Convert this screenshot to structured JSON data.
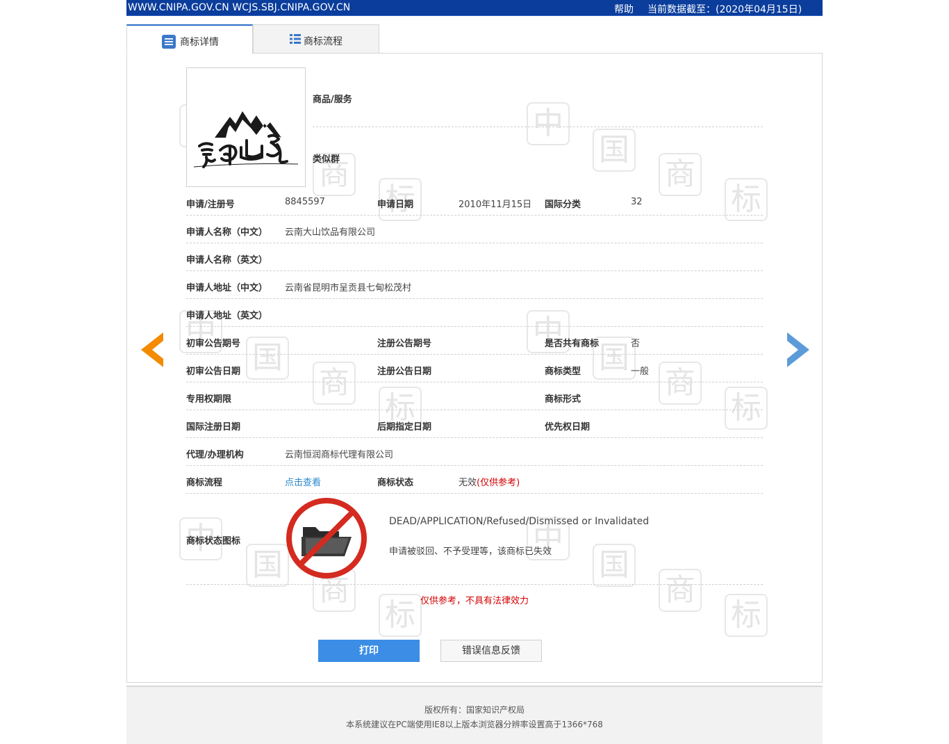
{
  "topbar": {
    "site": "WWW.CNIPA.GOV.CN WCJS.SBJ.CNIPA.GOV.CN",
    "help": "帮助",
    "date": "当前数据截至：(2020年04月15日)"
  },
  "tabs": [
    {
      "label": "商标详情"
    },
    {
      "label": "商标流程"
    }
  ],
  "watermark": {
    "chars": [
      "中",
      "国",
      "商",
      "标"
    ]
  },
  "logo": {
    "text": "雲南山泉"
  },
  "goods": {
    "label": "商品/服务",
    "value": ""
  },
  "similar_group": {
    "label": "类似群",
    "value": ""
  },
  "fields": {
    "reg_no": {
      "label": "申请/注册号",
      "value": "8845597"
    },
    "app_date": {
      "label": "申请日期",
      "value": "2010年11月15日"
    },
    "intl_class": {
      "label": "国际分类",
      "value": "32"
    },
    "applicant_cn": {
      "label": "申请人名称（中文）",
      "value": "云南大山饮品有限公司"
    },
    "applicant_en": {
      "label": "申请人名称（英文）",
      "value": ""
    },
    "address_cn": {
      "label": "申请人地址（中文）",
      "value": "云南省昆明市呈贡县七甸松茂村"
    },
    "address_en": {
      "label": "申请人地址（英文）",
      "value": ""
    },
    "prelim_pub_no": {
      "label": "初审公告期号",
      "value": ""
    },
    "reg_pub_no": {
      "label": "注册公告期号",
      "value": ""
    },
    "shared": {
      "label": "是否共有商标",
      "value": "否"
    },
    "prelim_pub_date": {
      "label": "初审公告日期",
      "value": ""
    },
    "reg_pub_date": {
      "label": "注册公告日期",
      "value": ""
    },
    "tm_type": {
      "label": "商标类型",
      "value": "一般"
    },
    "exclusive_period": {
      "label": "专用权期限",
      "value": ""
    },
    "tm_form": {
      "label": "商标形式",
      "value": ""
    },
    "intl_reg_date": {
      "label": "国际注册日期",
      "value": ""
    },
    "later_designation": {
      "label": "后期指定日期",
      "value": ""
    },
    "priority_date": {
      "label": "优先权日期",
      "value": ""
    },
    "agent": {
      "label": "代理/办理机构",
      "value": "云南恒润商标代理有限公司"
    },
    "flow": {
      "label": "商标流程",
      "value": "点击查看"
    },
    "status": {
      "label": "商标状态",
      "value": "无效",
      "note": "(仅供参考)"
    },
    "status_icon": {
      "label": "商标状态图标"
    }
  },
  "status_detail": {
    "en": "DEAD/APPLICATION/Refused/Dismissed or Invalidated",
    "cn": "申请被驳回、不予受理等，该商标已失效"
  },
  "disclaimer": "仅供参考，不具有法律效力",
  "buttons": {
    "print": "打印",
    "feedback": "错误信息反馈"
  },
  "footer": {
    "line1": "版权所有：国家知识产权局",
    "line2": "本系统建议在PC端使用IE8以上版本浏览器分辨率设置高于1366*768"
  },
  "colors": {
    "topbar": "#0a3d9c",
    "accent": "#3b8de6",
    "link": "#2a88d0",
    "alert": "#d40000",
    "arrow_left": "#f38a00",
    "arrow_right": "#5b9bd8"
  },
  "icons": [
    "list-icon",
    "grid-list-icon",
    "arrow-left-icon",
    "arrow-right-icon",
    "prohibited-folder-icon"
  ]
}
